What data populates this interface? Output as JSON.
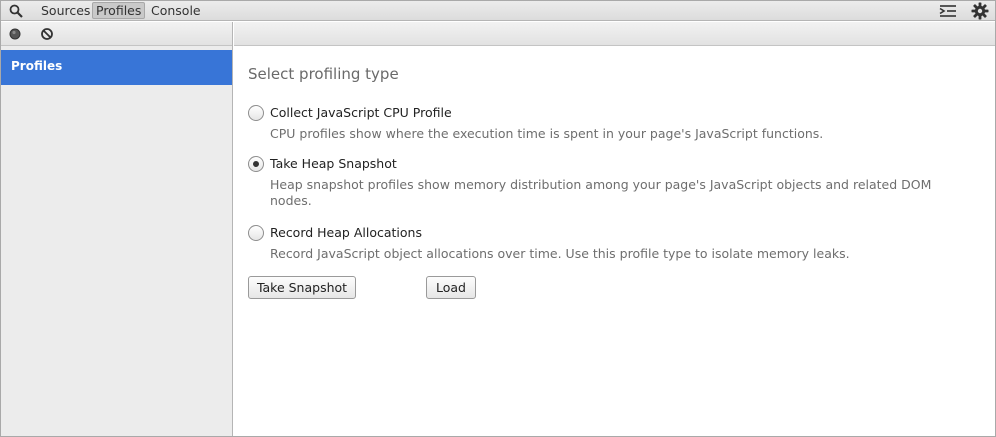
{
  "tabs": {
    "sources": "Sources",
    "profiles": "Profiles",
    "console": "Console"
  },
  "icons": {
    "search": "search-icon",
    "drawer": "show-drawer-icon",
    "settings": "gear-icon",
    "record": "record-icon",
    "clear": "clear-icon"
  },
  "sidebar": {
    "items": [
      {
        "label": "Profiles",
        "selected": true
      }
    ]
  },
  "main": {
    "title": "Select profiling type",
    "options": [
      {
        "label": "Collect JavaScript CPU Profile",
        "description": "CPU profiles show where the execution time is spent in your page's JavaScript functions.",
        "checked": false
      },
      {
        "label": "Take Heap Snapshot",
        "description": "Heap snapshot profiles show memory distribution among your page's JavaScript objects and related DOM nodes.",
        "checked": true
      },
      {
        "label": "Record Heap Allocations",
        "description": "Record JavaScript object allocations over time. Use this profile type to isolate memory leaks.",
        "checked": false
      }
    ],
    "buttons": {
      "take": "Take Snapshot",
      "load": "Load"
    }
  },
  "colors": {
    "selection": "#3875d7",
    "sidebar_bg": "#ececec"
  }
}
